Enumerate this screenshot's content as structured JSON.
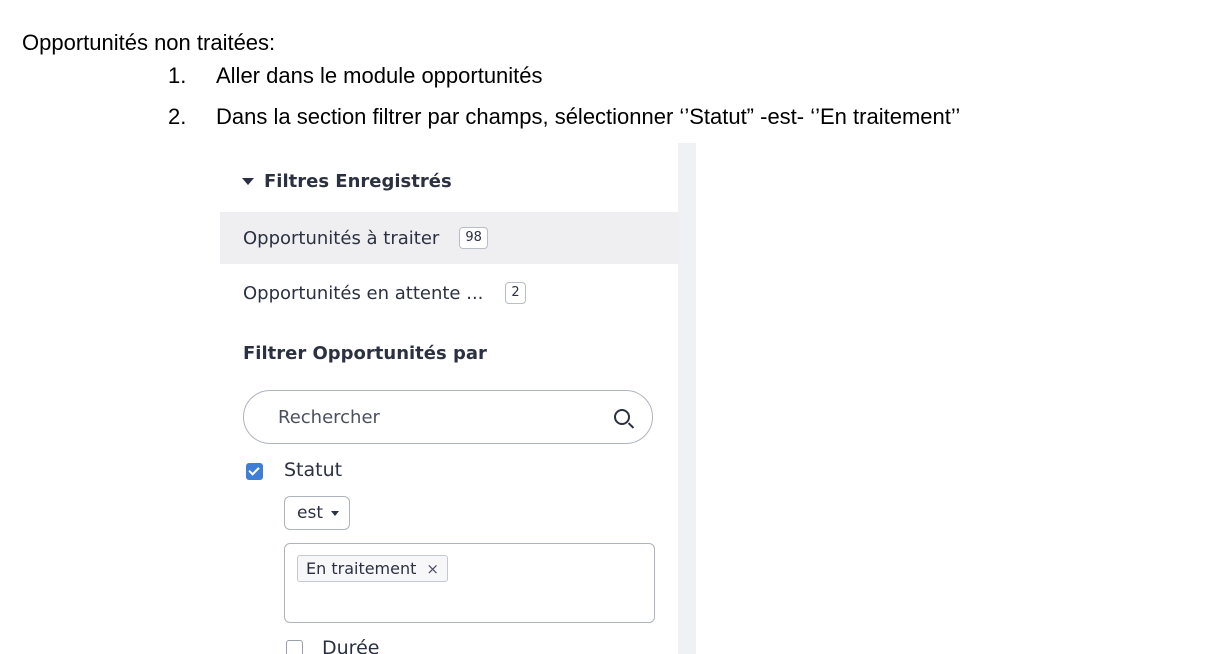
{
  "doc": {
    "heading": "Opportunités non traitées:",
    "steps": [
      {
        "num": "1.",
        "text": "Aller dans le module opportunités"
      },
      {
        "num": "2.",
        "text": "Dans la section filtrer par champs, sélectionner ‘’Statut” -est- ‘’En traitement’’"
      }
    ]
  },
  "panel": {
    "saved_filters_title": "Filtres Enregistrés",
    "saved_filters": [
      {
        "label": "Opportunités à traiter",
        "count": "98",
        "active": true
      },
      {
        "label": "Opportunités en attente ...",
        "count": "2",
        "active": false
      }
    ],
    "filter_by_title": "Filtrer Opportunités par",
    "search_placeholder": "Rechercher",
    "fields": [
      {
        "label": "Statut",
        "checked": true,
        "operator": "est",
        "tags": [
          "En traitement"
        ]
      },
      {
        "label": "Durée",
        "checked": false
      }
    ],
    "tag_close_symbol": "×"
  },
  "colors": {
    "active_row_bg": "#efeff2",
    "checkbox_accent": "#3d7ed6"
  }
}
